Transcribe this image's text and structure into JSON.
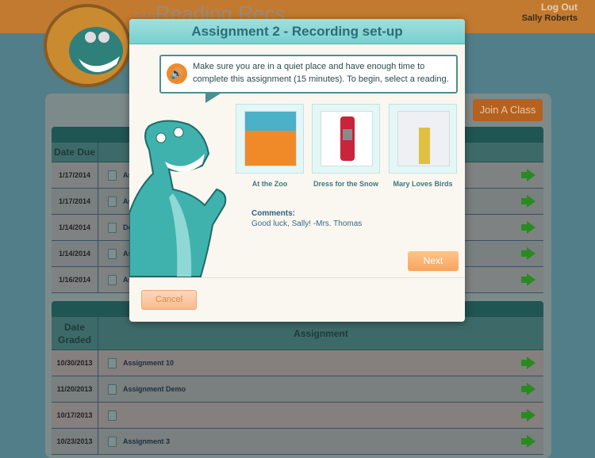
{
  "header": {
    "app_title": "Reading Recs",
    "brand_prefix": "SAS",
    "logout_label": "Log Out",
    "user_name": "Sally Roberts"
  },
  "join_button": "Join A Class",
  "due_table": {
    "date_header": "Date Due",
    "rows": [
      {
        "date": "1/17/2014",
        "name": "As"
      },
      {
        "date": "1/17/2014",
        "name": "As"
      },
      {
        "date": "1/14/2014",
        "name": "De"
      },
      {
        "date": "1/14/2014",
        "name": "As"
      },
      {
        "date": "1/16/2014",
        "name": "As"
      }
    ]
  },
  "graded_table": {
    "date_header": "Date Graded",
    "assignment_header": "Assignment",
    "rows": [
      {
        "date": "10/30/2013",
        "name": "Assignment 10"
      },
      {
        "date": "11/20/2013",
        "name": "Assignment Demo"
      },
      {
        "date": "10/17/2013",
        "name": ""
      },
      {
        "date": "10/23/2013",
        "name": "Assignment 3"
      }
    ]
  },
  "modal": {
    "title": "Assignment 2 - Recording set-up",
    "instructions": "Make sure you are in a quiet place and have enough time to complete this assignment (15 minutes). To begin, select a reading.",
    "readings": [
      {
        "label": "At the Zoo"
      },
      {
        "label": "Dress for the Snow"
      },
      {
        "label": "Mary Loves Birds"
      }
    ],
    "comments_label": "Comments:",
    "comments_text": "Good luck, Sally! -Mrs. Thomas",
    "next_label": "Next",
    "cancel_label": "Cancel"
  },
  "colors": {
    "header": "#c27a30",
    "accent_teal": "#7acfce",
    "next": "#f8a45e",
    "arrow": "#2a8a22"
  }
}
